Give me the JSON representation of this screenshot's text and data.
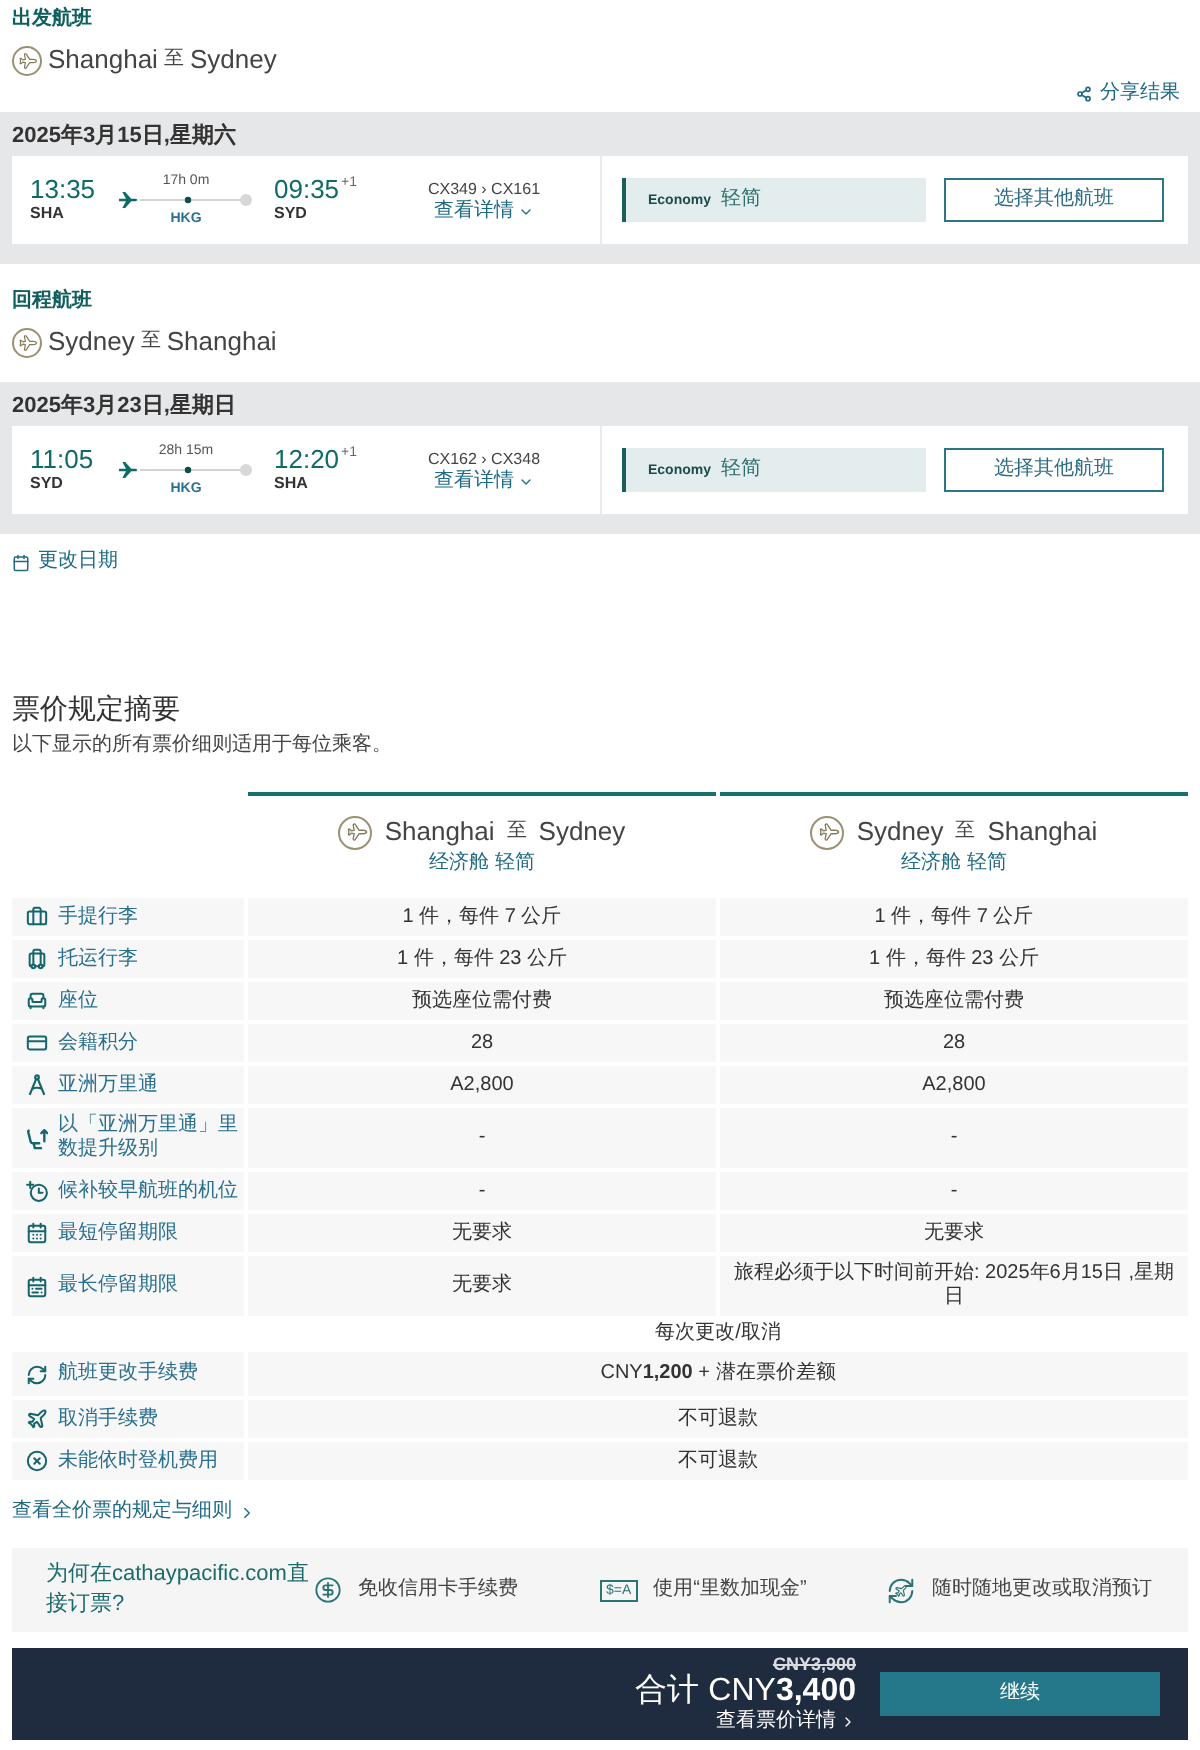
{
  "flights": [
    {
      "label": "出发航班",
      "origin": "Shanghai",
      "connector": "至",
      "destination": "Sydney",
      "share": "分享结果",
      "date": "2025年3月15日,星期六",
      "depart_time": "13:35",
      "depart_code": "SHA",
      "duration": "17h 0m",
      "stop": "HKG",
      "arrive_time": "09:35",
      "day_offset": "+1",
      "arrive_code": "SYD",
      "flight_numbers": "CX349 › CX161",
      "details_link": "查看详情",
      "cabin": "Economy",
      "fare": "轻简",
      "change_button": "选择其他航班"
    },
    {
      "label": "回程航班",
      "origin": "Sydney",
      "connector": "至",
      "destination": "Shanghai",
      "date": "2025年3月23日,星期日",
      "depart_time": "11:05",
      "depart_code": "SYD",
      "duration": "28h 15m",
      "stop": "HKG",
      "arrive_time": "12:20",
      "day_offset": "+1",
      "arrive_code": "SHA",
      "flight_numbers": "CX162 › CX348",
      "details_link": "查看详情",
      "cabin": "Economy",
      "fare": "轻简",
      "change_button": "选择其他航班"
    }
  ],
  "change_dates": "更改日期",
  "fare_summary": {
    "title": "票价规定摘要",
    "note": "以下显示的所有票价细则适用于每位乘客。",
    "columns": [
      {
        "origin": "Shanghai",
        "connector": "至",
        "destination": "Sydney",
        "fare": "经济舱 轻简"
      },
      {
        "origin": "Sydney",
        "connector": "至",
        "destination": "Shanghai",
        "fare": "经济舱 轻简"
      }
    ],
    "rows": [
      {
        "label": "手提行李",
        "values": [
          "1 件，每件 7 公斤",
          "1 件，每件 7 公斤"
        ]
      },
      {
        "label": "托运行李",
        "values": [
          "1 件，每件 23 公斤",
          "1 件，每件 23 公斤"
        ]
      },
      {
        "label": "座位",
        "values": [
          "预选座位需付费",
          "预选座位需付费"
        ]
      },
      {
        "label": "会籍积分",
        "values": [
          "28",
          "28"
        ]
      },
      {
        "label": "亚洲万里通",
        "values": [
          "A2,800",
          "A2,800"
        ]
      },
      {
        "label": "以「亚洲万里通」里数提升级别",
        "values": [
          "-",
          "-"
        ]
      },
      {
        "label": "候补较早航班的机位",
        "values": [
          "-",
          "-"
        ]
      },
      {
        "label": "最短停留期限",
        "values": [
          "无要求",
          "无要求"
        ]
      },
      {
        "label": "最长停留期限",
        "values": [
          "无要求",
          "旅程必须于以下时间前开始: 2025年6月15日 ,星期日"
        ]
      }
    ],
    "fees_heading": "每次更改/取消",
    "fees": [
      {
        "label": "航班更改手续费",
        "value": "CNY**1,200** + 潜在票价差额"
      },
      {
        "label": "取消手续费",
        "value": "不可退款"
      },
      {
        "label": "未能依时登机费用",
        "value": "不可退款"
      }
    ],
    "full_rules_link": "查看全价票的规定与细则"
  },
  "benefits": {
    "title": "为何在cathaypacific.com直接订票?",
    "items": [
      {
        "text": "免收信用卡手续费"
      },
      {
        "badge": "$=A",
        "text": "使用“里数加现金”"
      },
      {
        "text": "随时随地更改或取消预订"
      }
    ]
  },
  "checkout": {
    "original_price": "CNY3,900",
    "total": "合计 CNY**3,400**",
    "details_link": "查看票价详情",
    "button": "继续"
  }
}
